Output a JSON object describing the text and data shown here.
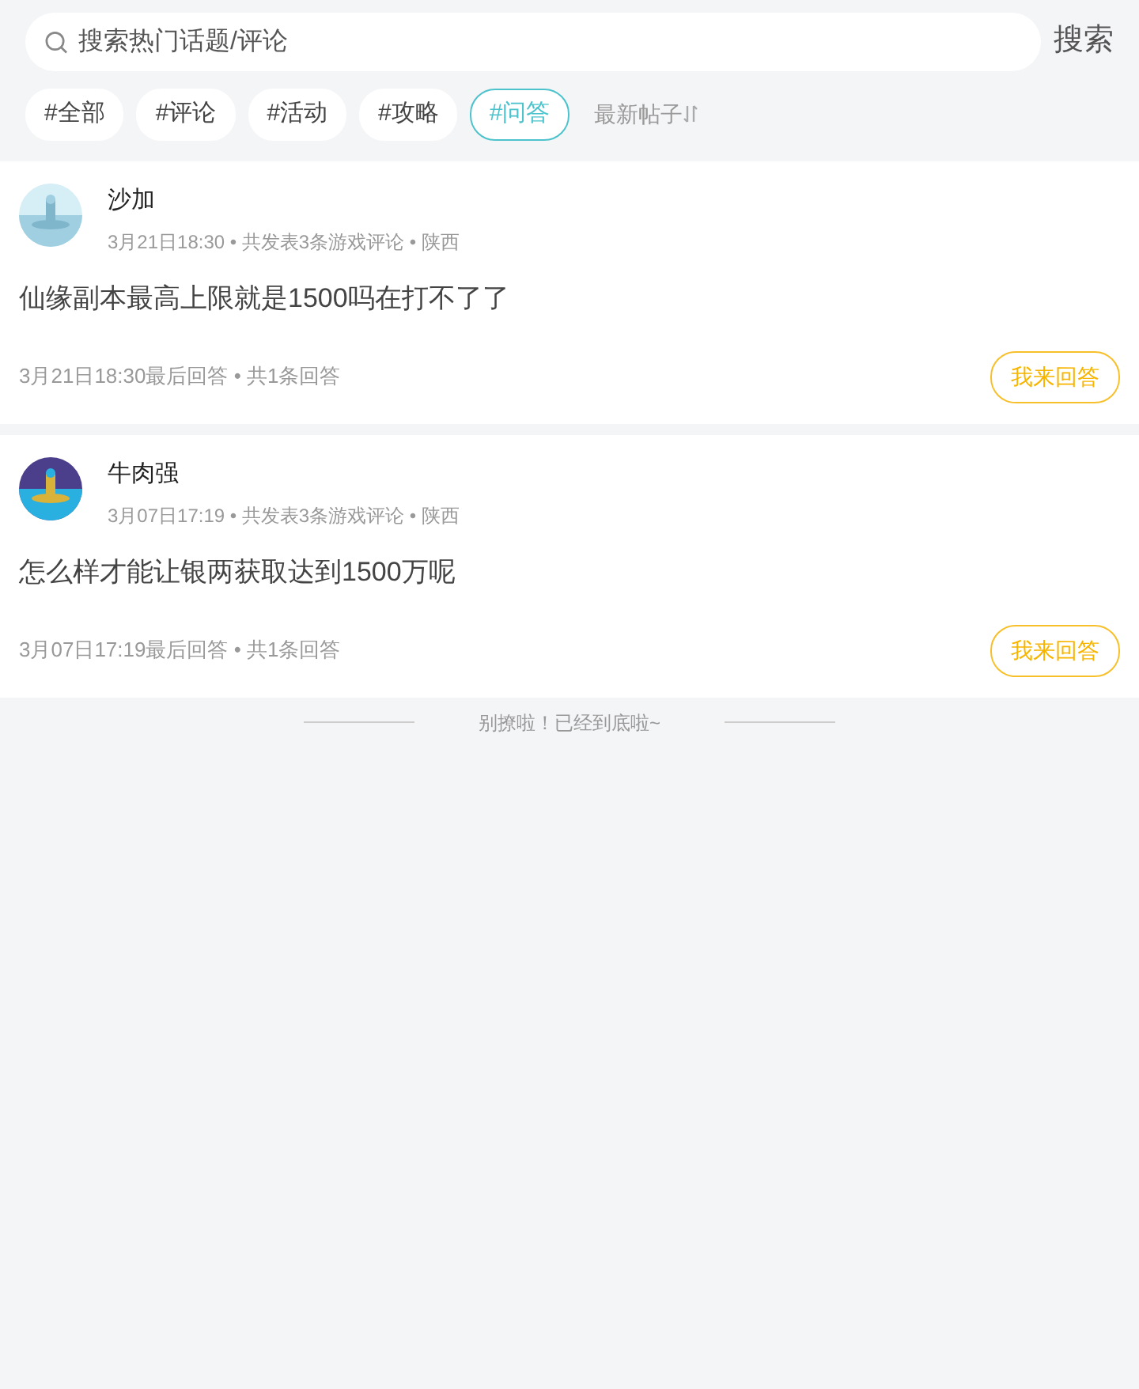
{
  "search": {
    "placeholder": "搜索热门话题/评论",
    "button": "搜索"
  },
  "tags": [
    {
      "label": "#全部",
      "selected": false
    },
    {
      "label": "#评论",
      "selected": false
    },
    {
      "label": "#活动",
      "selected": false
    },
    {
      "label": "#攻略",
      "selected": false
    },
    {
      "label": "#问答",
      "selected": true
    }
  ],
  "sort": {
    "label": "最新帖子"
  },
  "posts": [
    {
      "author": "沙加",
      "meta": "3月21日18:30 • 共发表3条游戏评论 • 陕西",
      "title": "仙缘副本最高上限就是1500吗在打不了了",
      "footer": "3月21日18:30最后回答 • 共1条回答",
      "button": "我来回答"
    },
    {
      "author": "牛肉强",
      "meta": "3月07日17:19 • 共发表3条游戏评论 • 陕西",
      "title": "怎么样才能让银两获取达到1500万呢",
      "footer": "3月07日17:19最后回答 • 共1条回答",
      "button": "我来回答"
    }
  ],
  "end_note": "别撩啦！已经到底啦~"
}
